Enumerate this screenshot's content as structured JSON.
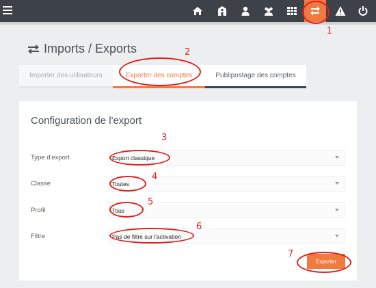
{
  "nav": {
    "icons": [
      "menu-icon",
      "home-icon",
      "school-icon",
      "user-icon",
      "users-icon",
      "grid-icon",
      "transfer-icon",
      "warning-icon",
      "power-icon"
    ],
    "active": "transfer-icon",
    "active_color": "#f07a3f",
    "bar_color": "#3d4148"
  },
  "page": {
    "title": "Imports / Exports"
  },
  "tabs": [
    {
      "label": "Importer des utilisateurs"
    },
    {
      "label": "Exporter des comptes"
    },
    {
      "label": "Publipostage des comptes"
    }
  ],
  "panel": {
    "title": "Configuration de l'export",
    "fields": [
      {
        "label": "Type d'export",
        "value": "Export classique"
      },
      {
        "label": "Classe",
        "value": "Toutes"
      },
      {
        "label": "Profil",
        "value": "Tous"
      },
      {
        "label": "Filtre",
        "value": "Pas de filtre sur l'activation"
      }
    ],
    "button": "Exporter"
  },
  "annotations": {
    "color": "#e0201d",
    "numbers": [
      "1",
      "2",
      "3",
      "4",
      "5",
      "6",
      "7"
    ]
  }
}
